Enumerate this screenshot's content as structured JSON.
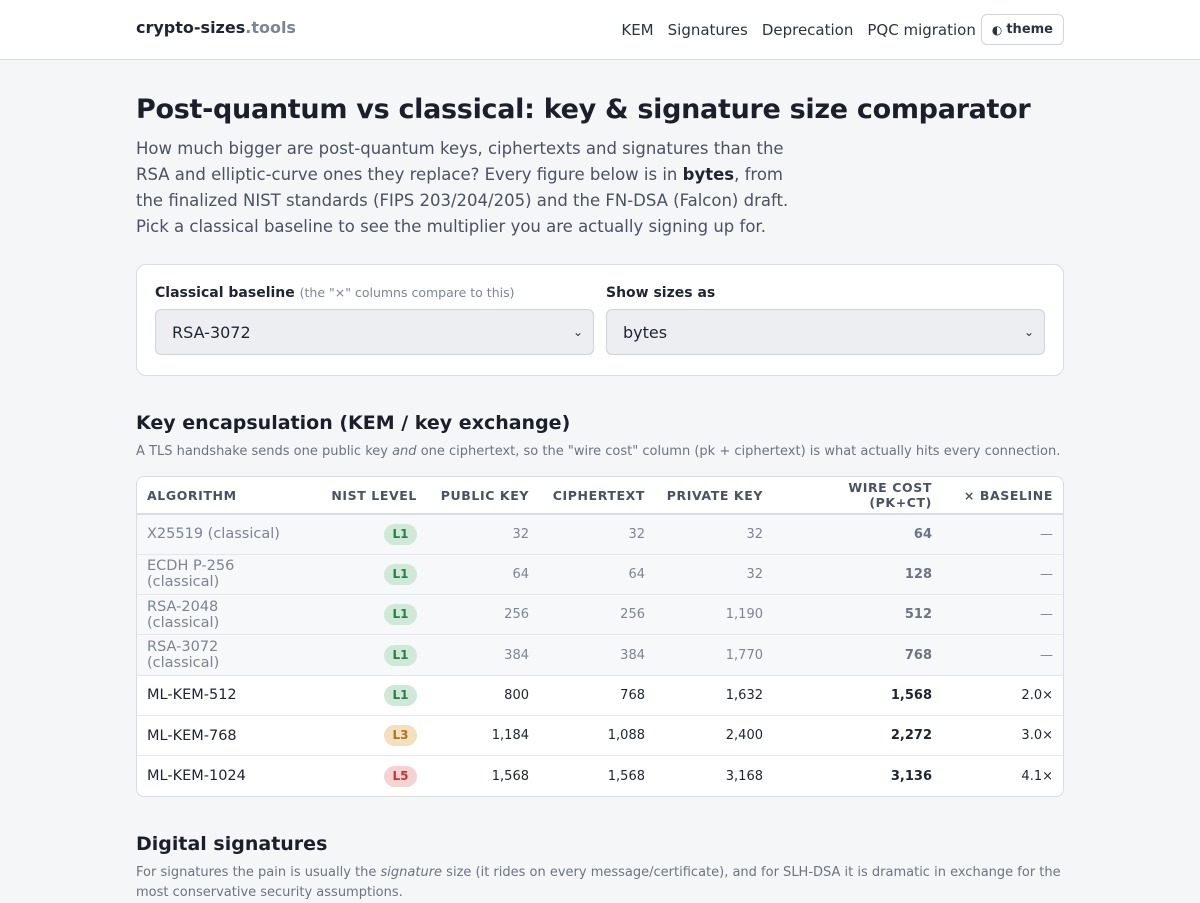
{
  "brand": {
    "name": "crypto-sizes",
    "tld": ".tools"
  },
  "nav": {
    "items": [
      "KEM",
      "Signatures",
      "Deprecation",
      "PQC migration"
    ],
    "theme_icon": "half-circle-icon",
    "theme_label": "theme"
  },
  "page": {
    "title": "Post-quantum vs classical: key & signature size comparator",
    "intro_1": "How much bigger are post-quantum keys, ciphertexts and signatures than the RSA and elliptic-curve ones they replace? Every figure below is in ",
    "intro_bold": "bytes",
    "intro_2": ", from the finalized NIST standards (FIPS 203/204/205) and the FN-DSA (Falcon) draft. Pick a classical baseline to see the multiplier you are actually signing up for."
  },
  "controls": {
    "baseline_label": "Classical baseline",
    "baseline_hint": "(the \"×\" columns compare to this)",
    "baseline_value": "RSA-3072",
    "units_label": "Show sizes as",
    "units_value": "bytes"
  },
  "kem": {
    "title": "Key encapsulation (KEM / key exchange)",
    "desc_1": "A TLS handshake sends one public key ",
    "desc_em": "and",
    "desc_2": " one ciphertext, so the \"wire cost\" column (pk + ciphertext) is what actually hits every connection.",
    "headers": [
      "ALGORITHM",
      "NIST LEVEL",
      "PUBLIC KEY",
      "CIPHERTEXT",
      "PRIVATE KEY",
      "WIRE COST (PK+CT)",
      "× BASELINE"
    ],
    "rows": [
      {
        "algo": "X25519 (classical)",
        "level": "L1",
        "pk": "32",
        "ct": "32",
        "sk": "32",
        "wire": "64",
        "mult": "—",
        "classical": true
      },
      {
        "algo": "ECDH P-256 (classical)",
        "level": "L1",
        "pk": "64",
        "ct": "64",
        "sk": "32",
        "wire": "128",
        "mult": "—",
        "classical": true
      },
      {
        "algo": "RSA-2048 (classical)",
        "level": "L1",
        "pk": "256",
        "ct": "256",
        "sk": "1,190",
        "wire": "512",
        "mult": "—",
        "classical": true
      },
      {
        "algo": "RSA-3072 (classical)",
        "level": "L1",
        "pk": "384",
        "ct": "384",
        "sk": "1,770",
        "wire": "768",
        "mult": "—",
        "classical": true
      },
      {
        "algo": "ML-KEM-512",
        "level": "L1",
        "pk": "800",
        "ct": "768",
        "sk": "1,632",
        "wire": "1,568",
        "mult": "2.0×",
        "classical": false
      },
      {
        "algo": "ML-KEM-768",
        "level": "L3",
        "pk": "1,184",
        "ct": "1,088",
        "sk": "2,400",
        "wire": "2,272",
        "mult": "3.0×",
        "classical": false
      },
      {
        "algo": "ML-KEM-1024",
        "level": "L5",
        "pk": "1,568",
        "ct": "1,568",
        "sk": "3,168",
        "wire": "3,136",
        "mult": "4.1×",
        "classical": false
      }
    ]
  },
  "sig": {
    "title": "Digital signatures",
    "desc_1": "For signatures the pain is usually the ",
    "desc_em": "signature",
    "desc_2": " size (it rides on every message/certificate), and for SLH-DSA it is dramatic in exchange for the most conservative security assumptions."
  },
  "colors": {
    "L1": "#2a7d48",
    "L3": "#b0731a",
    "L5": "#c43636",
    "background": "#f5f6f8"
  }
}
